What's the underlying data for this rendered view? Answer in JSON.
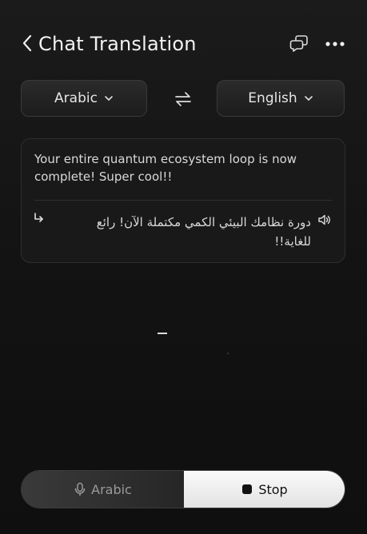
{
  "header": {
    "title": "Chat Translation",
    "back_icon": "chevron-left-icon",
    "chat_icon": "chat-bubbles-icon",
    "more_icon": "more-horizontal-icon"
  },
  "languages": {
    "source": "Arabic",
    "target": "English",
    "swap_icon": "swap-arrows-icon",
    "dropdown_icon": "chevron-down-icon"
  },
  "card": {
    "source_text": "Your entire quantum ecosystem loop is now complete! Super cool!!",
    "translated_text": "دورة نظامك البيئي الكمي مكتملة الآن! رائع للغاية!!",
    "reply_icon": "reply-arrow-icon",
    "speaker_icon": "speaker-icon"
  },
  "controls": {
    "mic_label": "Arabic",
    "mic_icon": "microphone-icon",
    "stop_label": "Stop",
    "stop_icon": "stop-icon"
  },
  "colors": {
    "background": "#121212",
    "card": "#191919",
    "text": "#e9e9e9",
    "stop_bg": "#f2f2f2"
  }
}
